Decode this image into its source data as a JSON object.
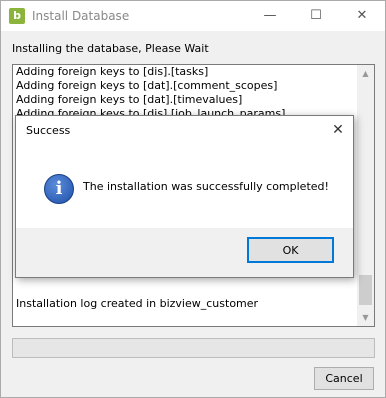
{
  "window": {
    "title": "Install Database",
    "app_icon_letter": "b",
    "controls": {
      "minimize": "—",
      "maximize": "☐",
      "close": "✕"
    }
  },
  "status_text": "Installing the database, Please Wait",
  "log": {
    "lines": [
      "Adding foreign keys to [dis].[tasks]",
      "Adding foreign keys to [dat].[comment_scopes]",
      "Adding foreign keys to [dat].[timevalues]",
      "Adding foreign keys to [dis].[job_launch_params]"
    ],
    "last_line": "Installation log created in bizview_customer"
  },
  "progress": {
    "value": 0
  },
  "buttons": {
    "cancel": "Cancel"
  },
  "dialog": {
    "title": "Success",
    "message": "The installation was successfully completed!",
    "ok_label": "OK",
    "close_glyph": "✕",
    "icon_glyph": "i"
  },
  "colors": {
    "app_icon": "#8cb43c",
    "info_icon": "#1d4fa8",
    "focus_border": "#0078d7"
  }
}
